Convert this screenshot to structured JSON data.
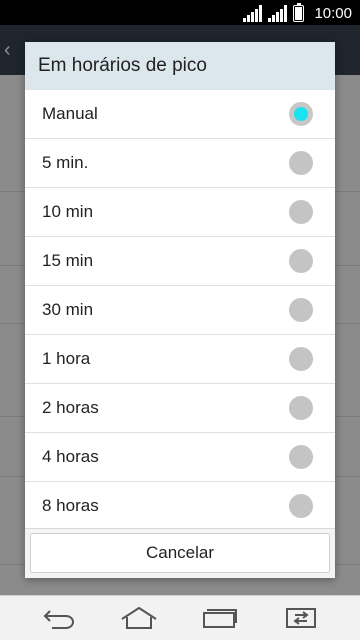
{
  "status_bar": {
    "time": "10:00"
  },
  "dialog": {
    "title": "Em horários de pico",
    "options": [
      {
        "label": "Manual",
        "selected": true
      },
      {
        "label": "5 min.",
        "selected": false
      },
      {
        "label": "10 min",
        "selected": false
      },
      {
        "label": "15 min",
        "selected": false
      },
      {
        "label": "30 min",
        "selected": false
      },
      {
        "label": "1 hora",
        "selected": false
      },
      {
        "label": "2 horas",
        "selected": false
      },
      {
        "label": "4 horas",
        "selected": false
      },
      {
        "label": "8 horas",
        "selected": false
      }
    ],
    "cancel_label": "Cancelar",
    "accent_color": "#19e3ef"
  },
  "nav_icons": [
    "back-icon",
    "home-icon",
    "recent-apps-icon",
    "switch-icon"
  ]
}
